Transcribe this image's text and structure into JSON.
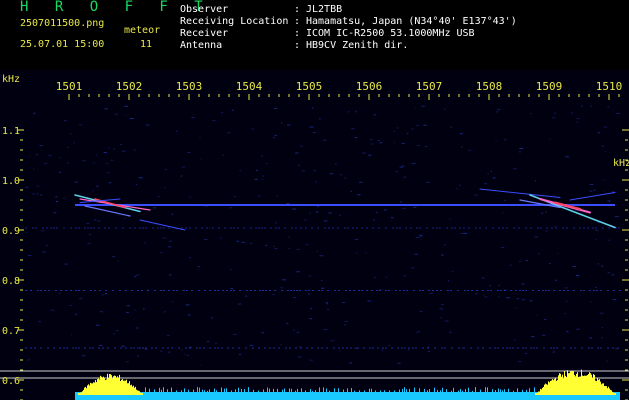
{
  "header": {
    "title": "H R O F F T",
    "filename": "2507011500.png",
    "datetime": "25.07.01 15:00",
    "meteor_label": "meteor",
    "meteor_count": "11",
    "fields": [
      {
        "label": "Observer",
        "value": "JL2TBB"
      },
      {
        "label": "Receiving Location",
        "value": "Hamamatsu, Japan (N34°40' E137°43')"
      },
      {
        "label": "Receiver",
        "value": "ICOM IC-R2500 53.1000MHz USB"
      },
      {
        "label": "Antenna",
        "value": "HB9CV Zenith dir."
      }
    ]
  },
  "axis": {
    "unit": "kHz",
    "x_ticks": [
      "1501",
      "1502",
      "1503",
      "1504",
      "1505",
      "1506",
      "1507",
      "1508",
      "1509",
      "1510"
    ],
    "y_ticks": [
      "1.1",
      "1.0",
      "0.9",
      "0.8",
      "0.7",
      "0.6"
    ]
  },
  "colors": {
    "background": "#000000",
    "axis_label": "#e8e84a",
    "title": "#19d864",
    "header_text": "#ffffff",
    "carrier": "#3a4dff",
    "meteor_trace": "#5fd0e8",
    "histogram": "#ffff33",
    "baseline": "#19c8ff"
  }
}
